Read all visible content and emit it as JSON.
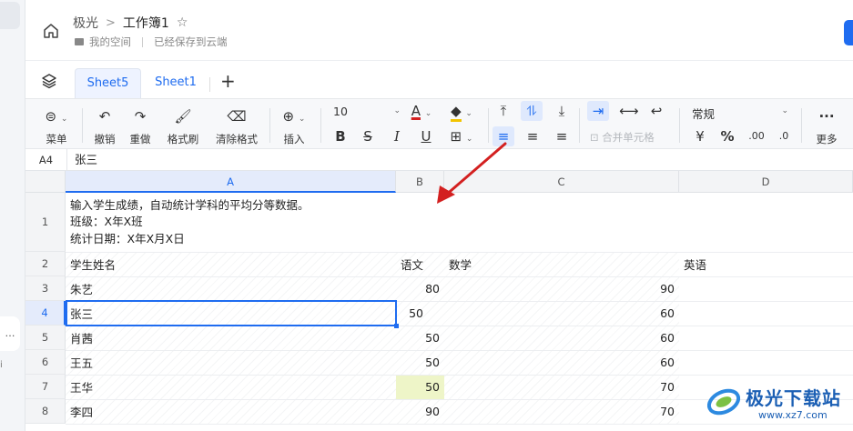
{
  "sidebar": {
    "pill_label": "…",
    "dot_label": "i"
  },
  "header": {
    "breadcrumb_root": "极光",
    "breadcrumb_sep": ">",
    "doc_title": "工作簿1",
    "location": "我的空间",
    "save_status": "已经保存到云端"
  },
  "tabs": {
    "items": [
      {
        "label": "Sheet5",
        "active": true
      },
      {
        "label": "Sheet1",
        "active": false
      }
    ],
    "add": "+"
  },
  "toolbar": {
    "menu": "菜单",
    "undo": "撤销",
    "redo": "重做",
    "format_painter": "格式刷",
    "clear_format": "清除格式",
    "insert": "插入",
    "font_size": "10",
    "merge_cells": "合并单元格",
    "number_format": "常规",
    "more": "更多",
    "currency": "¥",
    "percent": "%",
    "dec_inc": ".00",
    "dec_dec": ".0"
  },
  "formula_bar": {
    "cell_ref": "A4",
    "value": "张三"
  },
  "grid": {
    "columns": [
      "A",
      "B",
      "C",
      "D"
    ],
    "rows": [
      "1",
      "2",
      "3",
      "4",
      "5",
      "6",
      "7",
      "8"
    ],
    "row1": {
      "line1": "输入学生成绩，自动统计学科的平均分等数据。",
      "line2": "班级：X年X班",
      "line3": "统计日期：X年X月X日"
    },
    "header_row": {
      "name": "学生姓名",
      "chinese": "语文",
      "math": "数学",
      "english": "英语"
    },
    "data": [
      {
        "name": "朱艺",
        "chinese": "80",
        "math": "90"
      },
      {
        "name": "张三",
        "chinese": "50",
        "math": "60"
      },
      {
        "name": "肖茜",
        "chinese": "50",
        "math": "60"
      },
      {
        "name": "王五",
        "chinese": "50",
        "math": "60"
      },
      {
        "name": "王华",
        "chinese": "50",
        "math": "70"
      },
      {
        "name": "李四",
        "chinese": "90",
        "math": "70"
      }
    ]
  },
  "watermark": {
    "brand": "极光下载站",
    "url": "www.xz7.com"
  },
  "colors": {
    "accent": "#1f6cf0",
    "arrow": "#d32020",
    "highlight": "#eef5c8"
  }
}
